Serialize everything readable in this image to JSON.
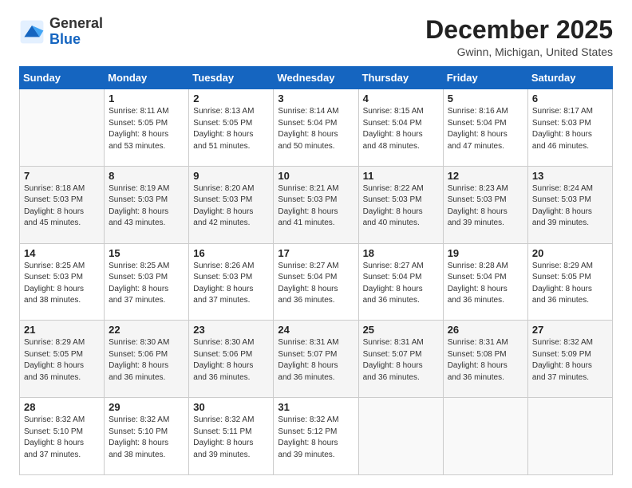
{
  "logo": {
    "general": "General",
    "blue": "Blue"
  },
  "title": "December 2025",
  "location": "Gwinn, Michigan, United States",
  "days_of_week": [
    "Sunday",
    "Monday",
    "Tuesday",
    "Wednesday",
    "Thursday",
    "Friday",
    "Saturday"
  ],
  "weeks": [
    [
      {
        "day": "",
        "info": ""
      },
      {
        "day": "1",
        "info": "Sunrise: 8:11 AM\nSunset: 5:05 PM\nDaylight: 8 hours\nand 53 minutes."
      },
      {
        "day": "2",
        "info": "Sunrise: 8:13 AM\nSunset: 5:05 PM\nDaylight: 8 hours\nand 51 minutes."
      },
      {
        "day": "3",
        "info": "Sunrise: 8:14 AM\nSunset: 5:04 PM\nDaylight: 8 hours\nand 50 minutes."
      },
      {
        "day": "4",
        "info": "Sunrise: 8:15 AM\nSunset: 5:04 PM\nDaylight: 8 hours\nand 48 minutes."
      },
      {
        "day": "5",
        "info": "Sunrise: 8:16 AM\nSunset: 5:04 PM\nDaylight: 8 hours\nand 47 minutes."
      },
      {
        "day": "6",
        "info": "Sunrise: 8:17 AM\nSunset: 5:03 PM\nDaylight: 8 hours\nand 46 minutes."
      }
    ],
    [
      {
        "day": "7",
        "info": "Sunrise: 8:18 AM\nSunset: 5:03 PM\nDaylight: 8 hours\nand 45 minutes."
      },
      {
        "day": "8",
        "info": "Sunrise: 8:19 AM\nSunset: 5:03 PM\nDaylight: 8 hours\nand 43 minutes."
      },
      {
        "day": "9",
        "info": "Sunrise: 8:20 AM\nSunset: 5:03 PM\nDaylight: 8 hours\nand 42 minutes."
      },
      {
        "day": "10",
        "info": "Sunrise: 8:21 AM\nSunset: 5:03 PM\nDaylight: 8 hours\nand 41 minutes."
      },
      {
        "day": "11",
        "info": "Sunrise: 8:22 AM\nSunset: 5:03 PM\nDaylight: 8 hours\nand 40 minutes."
      },
      {
        "day": "12",
        "info": "Sunrise: 8:23 AM\nSunset: 5:03 PM\nDaylight: 8 hours\nand 39 minutes."
      },
      {
        "day": "13",
        "info": "Sunrise: 8:24 AM\nSunset: 5:03 PM\nDaylight: 8 hours\nand 39 minutes."
      }
    ],
    [
      {
        "day": "14",
        "info": "Sunrise: 8:25 AM\nSunset: 5:03 PM\nDaylight: 8 hours\nand 38 minutes."
      },
      {
        "day": "15",
        "info": "Sunrise: 8:25 AM\nSunset: 5:03 PM\nDaylight: 8 hours\nand 37 minutes."
      },
      {
        "day": "16",
        "info": "Sunrise: 8:26 AM\nSunset: 5:03 PM\nDaylight: 8 hours\nand 37 minutes."
      },
      {
        "day": "17",
        "info": "Sunrise: 8:27 AM\nSunset: 5:04 PM\nDaylight: 8 hours\nand 36 minutes."
      },
      {
        "day": "18",
        "info": "Sunrise: 8:27 AM\nSunset: 5:04 PM\nDaylight: 8 hours\nand 36 minutes."
      },
      {
        "day": "19",
        "info": "Sunrise: 8:28 AM\nSunset: 5:04 PM\nDaylight: 8 hours\nand 36 minutes."
      },
      {
        "day": "20",
        "info": "Sunrise: 8:29 AM\nSunset: 5:05 PM\nDaylight: 8 hours\nand 36 minutes."
      }
    ],
    [
      {
        "day": "21",
        "info": "Sunrise: 8:29 AM\nSunset: 5:05 PM\nDaylight: 8 hours\nand 36 minutes."
      },
      {
        "day": "22",
        "info": "Sunrise: 8:30 AM\nSunset: 5:06 PM\nDaylight: 8 hours\nand 36 minutes."
      },
      {
        "day": "23",
        "info": "Sunrise: 8:30 AM\nSunset: 5:06 PM\nDaylight: 8 hours\nand 36 minutes."
      },
      {
        "day": "24",
        "info": "Sunrise: 8:31 AM\nSunset: 5:07 PM\nDaylight: 8 hours\nand 36 minutes."
      },
      {
        "day": "25",
        "info": "Sunrise: 8:31 AM\nSunset: 5:07 PM\nDaylight: 8 hours\nand 36 minutes."
      },
      {
        "day": "26",
        "info": "Sunrise: 8:31 AM\nSunset: 5:08 PM\nDaylight: 8 hours\nand 36 minutes."
      },
      {
        "day": "27",
        "info": "Sunrise: 8:32 AM\nSunset: 5:09 PM\nDaylight: 8 hours\nand 37 minutes."
      }
    ],
    [
      {
        "day": "28",
        "info": "Sunrise: 8:32 AM\nSunset: 5:10 PM\nDaylight: 8 hours\nand 37 minutes."
      },
      {
        "day": "29",
        "info": "Sunrise: 8:32 AM\nSunset: 5:10 PM\nDaylight: 8 hours\nand 38 minutes."
      },
      {
        "day": "30",
        "info": "Sunrise: 8:32 AM\nSunset: 5:11 PM\nDaylight: 8 hours\nand 39 minutes."
      },
      {
        "day": "31",
        "info": "Sunrise: 8:32 AM\nSunset: 5:12 PM\nDaylight: 8 hours\nand 39 minutes."
      },
      {
        "day": "",
        "info": ""
      },
      {
        "day": "",
        "info": ""
      },
      {
        "day": "",
        "info": ""
      }
    ]
  ]
}
